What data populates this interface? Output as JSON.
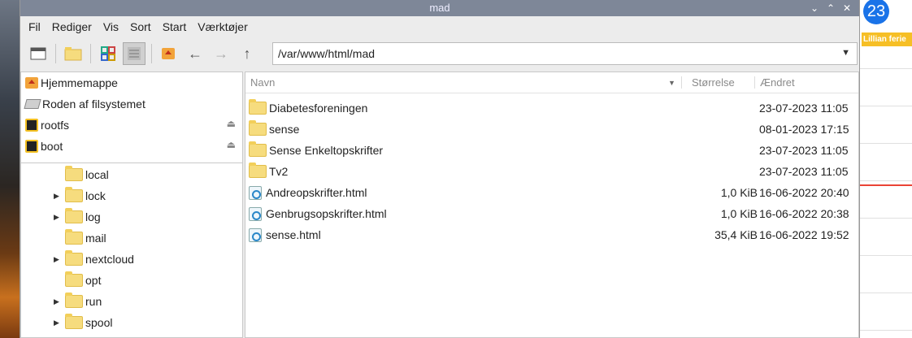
{
  "window": {
    "title": "mad"
  },
  "menu": [
    "Fil",
    "Rediger",
    "Vis",
    "Sort",
    "Start",
    "Værktøjer"
  ],
  "address": {
    "path": "/var/www/html/mad"
  },
  "places": [
    {
      "label": "Hjemmemappe",
      "icon": "home-icon"
    },
    {
      "label": "Roden af filsystemet",
      "icon": "drive-icon"
    },
    {
      "label": "rootfs",
      "icon": "disk-icon",
      "eject": true
    },
    {
      "label": "boot",
      "icon": "disk-icon",
      "eject": true
    }
  ],
  "tree": [
    {
      "label": "local",
      "expander": false
    },
    {
      "label": "lock",
      "expander": true
    },
    {
      "label": "log",
      "expander": true
    },
    {
      "label": "mail",
      "expander": false
    },
    {
      "label": "nextcloud",
      "expander": true
    },
    {
      "label": "opt",
      "expander": false
    },
    {
      "label": "run",
      "expander": true
    },
    {
      "label": "spool",
      "expander": true
    }
  ],
  "columns": {
    "name": "Navn",
    "size": "Størrelse",
    "modified": "Ændret"
  },
  "files": [
    {
      "name": "Diabetesforeningen",
      "size": "",
      "modified": "23-07-2023 11:05",
      "type": "folder"
    },
    {
      "name": "sense",
      "size": "",
      "modified": "08-01-2023 17:15",
      "type": "folder"
    },
    {
      "name": "Sense Enkeltopskrifter",
      "size": "",
      "modified": "23-07-2023 11:05",
      "type": "folder"
    },
    {
      "name": "Tv2",
      "size": "",
      "modified": "23-07-2023 11:05",
      "type": "folder"
    },
    {
      "name": "Andreopskrifter.html",
      "size": "1,0 KiB",
      "modified": "16-06-2022 20:40",
      "type": "html"
    },
    {
      "name": "Genbrugsopskrifter.html",
      "size": "1,0 KiB",
      "modified": "16-06-2022 20:38",
      "type": "html"
    },
    {
      "name": "sense.html",
      "size": "35,4 KiB",
      "modified": "16-06-2022 19:52",
      "type": "html"
    }
  ],
  "calendar": {
    "day": "23",
    "event": "Lillian ferie"
  }
}
